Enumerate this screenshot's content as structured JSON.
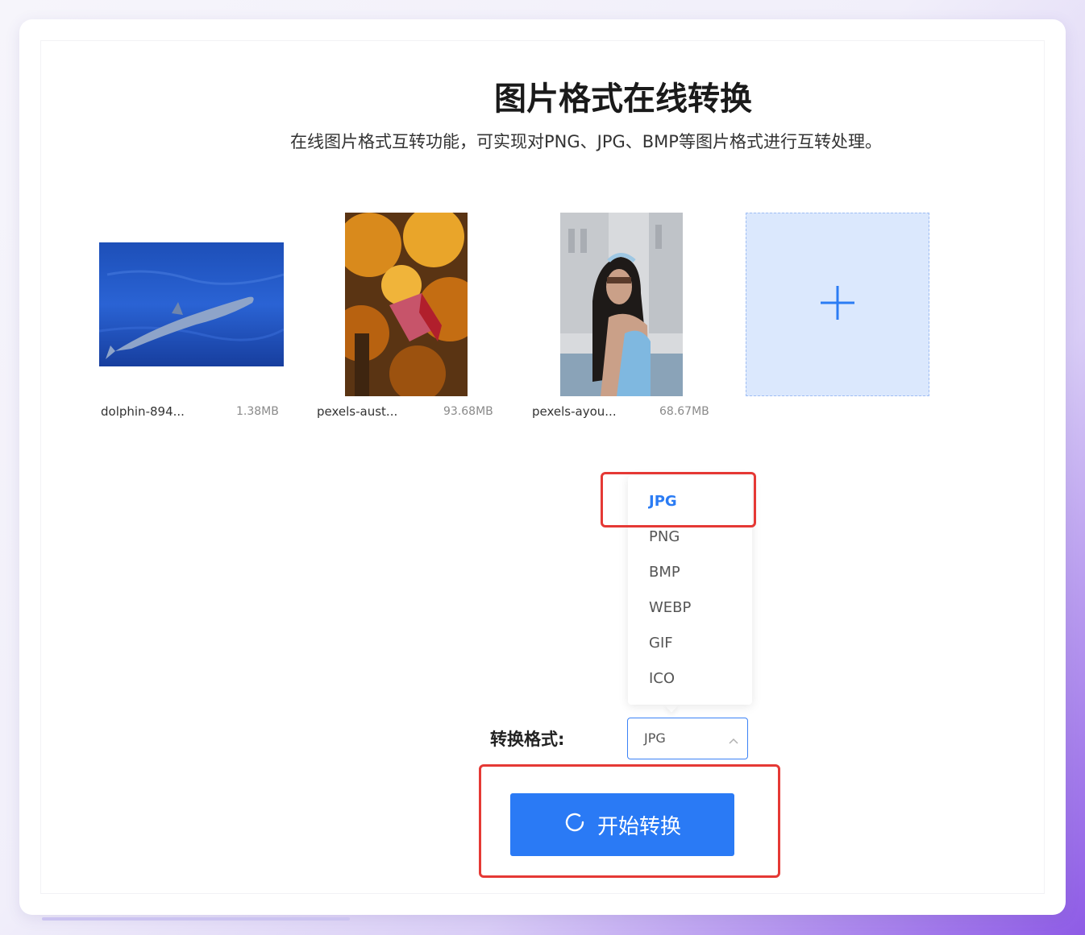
{
  "header": {
    "title": "图片格式在线转换",
    "subtitle": "在线图片格式互转功能，可实现对PNG、JPG、BMP等图片格式进行互转处理。"
  },
  "files": [
    {
      "name": "dolphin-894...",
      "size": "1.38MB"
    },
    {
      "name": "pexels-aust...",
      "size": "93.68MB"
    },
    {
      "name": "pexels-ayou...",
      "size": "68.67MB"
    }
  ],
  "upload": {
    "icon": "plus-icon"
  },
  "dropdown": {
    "options": [
      "JPG",
      "PNG",
      "BMP",
      "WEBP",
      "GIF",
      "ICO"
    ],
    "selected": "JPG"
  },
  "format": {
    "label": "转换格式:",
    "value": "JPG"
  },
  "convert_button": {
    "label": "开始转换",
    "icon": "refresh-icon"
  },
  "colors": {
    "accent": "#2a7af5",
    "highlight": "#e53935",
    "upload_bg": "#dbe8fd"
  }
}
